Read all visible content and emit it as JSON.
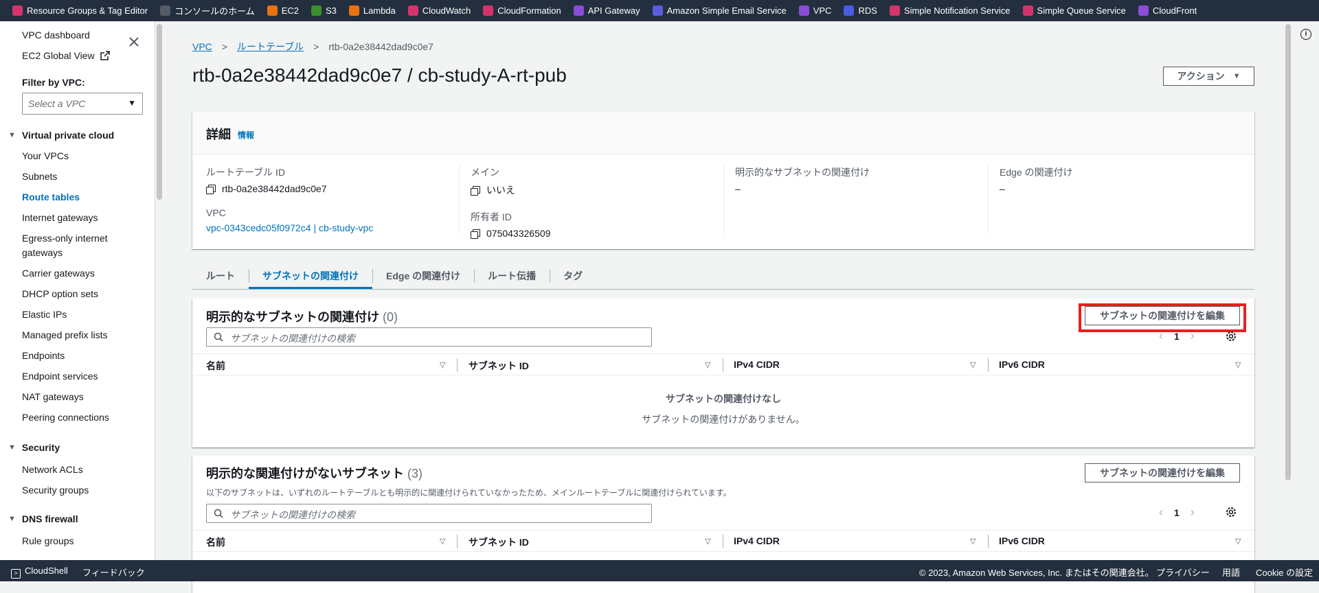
{
  "favorites": [
    {
      "label": "Resource Groups & Tag Editor",
      "color": "#d6336c",
      "icon": "resource-groups-icon"
    },
    {
      "label": "コンソールのホーム",
      "color": "#545b64",
      "icon": "console-home-icon"
    },
    {
      "label": "EC2",
      "color": "#ec7211",
      "icon": "ec2-icon"
    },
    {
      "label": "S3",
      "color": "#3b8e2c",
      "icon": "s3-icon"
    },
    {
      "label": "Lambda",
      "color": "#ec7211",
      "icon": "lambda-icon"
    },
    {
      "label": "CloudWatch",
      "color": "#d6336c",
      "icon": "cloudwatch-icon"
    },
    {
      "label": "CloudFormation",
      "color": "#d6336c",
      "icon": "cloudformation-icon"
    },
    {
      "label": "API Gateway",
      "color": "#8a4cd9",
      "icon": "api-gateway-icon"
    },
    {
      "label": "Amazon Simple Email Service",
      "color": "#5a5ce0",
      "icon": "ses-icon"
    },
    {
      "label": "VPC",
      "color": "#8a4cd9",
      "icon": "vpc-icon"
    },
    {
      "label": "RDS",
      "color": "#4a5ce0",
      "icon": "rds-icon"
    },
    {
      "label": "Simple Notification Service",
      "color": "#d6336c",
      "icon": "sns-icon"
    },
    {
      "label": "Simple Queue Service",
      "color": "#d6336c",
      "icon": "sqs-icon"
    },
    {
      "label": "CloudFront",
      "color": "#8a4cd9",
      "icon": "cloudfront-icon"
    }
  ],
  "sidebar": {
    "dashboard": "VPC dashboard",
    "ec2_global_view": "EC2 Global View",
    "filter_label": "Filter by VPC:",
    "filter_placeholder": "Select a VPC",
    "section_vpc": "Virtual private cloud",
    "vpc_items": [
      "Your VPCs",
      "Subnets",
      "Route tables",
      "Internet gateways",
      "Egress-only internet",
      "gateways",
      "Carrier gateways",
      "DHCP option sets",
      "Elastic IPs",
      "Managed prefix lists",
      "Endpoints",
      "Endpoint services",
      "NAT gateways",
      "Peering connections"
    ],
    "active_item": "Route tables",
    "section_security": "Security",
    "security_items": [
      "Network ACLs",
      "Security groups"
    ],
    "section_dns": "DNS firewall",
    "dns_items": [
      "Rule groups"
    ]
  },
  "breadcrumb": {
    "root": "VPC",
    "parent": "ルートテーブル",
    "current": "rtb-0a2e38442dad9c0e7"
  },
  "page": {
    "title": "rtb-0a2e38442dad9c0e7 / cb-study-A-rt-pub",
    "actions_label": "アクション"
  },
  "details": {
    "title": "詳細",
    "info_link": "情報",
    "route_table_id_label": "ルートテーブル ID",
    "route_table_id": "rtb-0a2e38442dad9c0e7",
    "vpc_label": "VPC",
    "vpc_value": "vpc-0343cedc05f0972c4 | cb-study-vpc",
    "main_label": "メイン",
    "main_value": "いいえ",
    "owner_label": "所有者 ID",
    "owner_value": "075043326509",
    "explicit_label": "明示的なサブネットの関連付け",
    "explicit_value": "–",
    "edge_label": "Edge の関連付け",
    "edge_value": "–"
  },
  "tabs": [
    "ルート",
    "サブネットの関連付け",
    "Edge の関連付け",
    "ルート伝播",
    "タグ"
  ],
  "active_tab": "サブネットの関連付け",
  "section_explicit": {
    "title": "明示的なサブネットの関連付け",
    "count": "(0)",
    "edit_button": "サブネットの関連付けを編集",
    "search_placeholder": "サブネットの関連付けの検索",
    "page": "1",
    "columns": [
      "名前",
      "サブネット ID",
      "IPv4 CIDR",
      "IPv6 CIDR"
    ],
    "empty_title": "サブネットの関連付けなし",
    "empty_desc": "サブネットの関連付けがありません。"
  },
  "section_implicit": {
    "title": "明示的な関連付けがないサブネット",
    "count": "(3)",
    "description": "以下のサブネットは、いずれのルートテーブルとも明示的に関連付けられていなかったため、メインルートテーブルに関連付けられています。",
    "edit_button": "サブネットの関連付けを編集",
    "search_placeholder": "サブネットの関連付けの検索",
    "page": "1",
    "columns": [
      "名前",
      "サブネット ID",
      "IPv4 CIDR",
      "IPv6 CIDR"
    ]
  },
  "footer": {
    "cloudshell": "CloudShell",
    "feedback": "フィードバック",
    "copyright": "© 2023, Amazon Web Services, Inc. またはその関連会社。",
    "privacy": "プライバシー",
    "terms": "用語",
    "cookie": "Cookie の設定"
  }
}
